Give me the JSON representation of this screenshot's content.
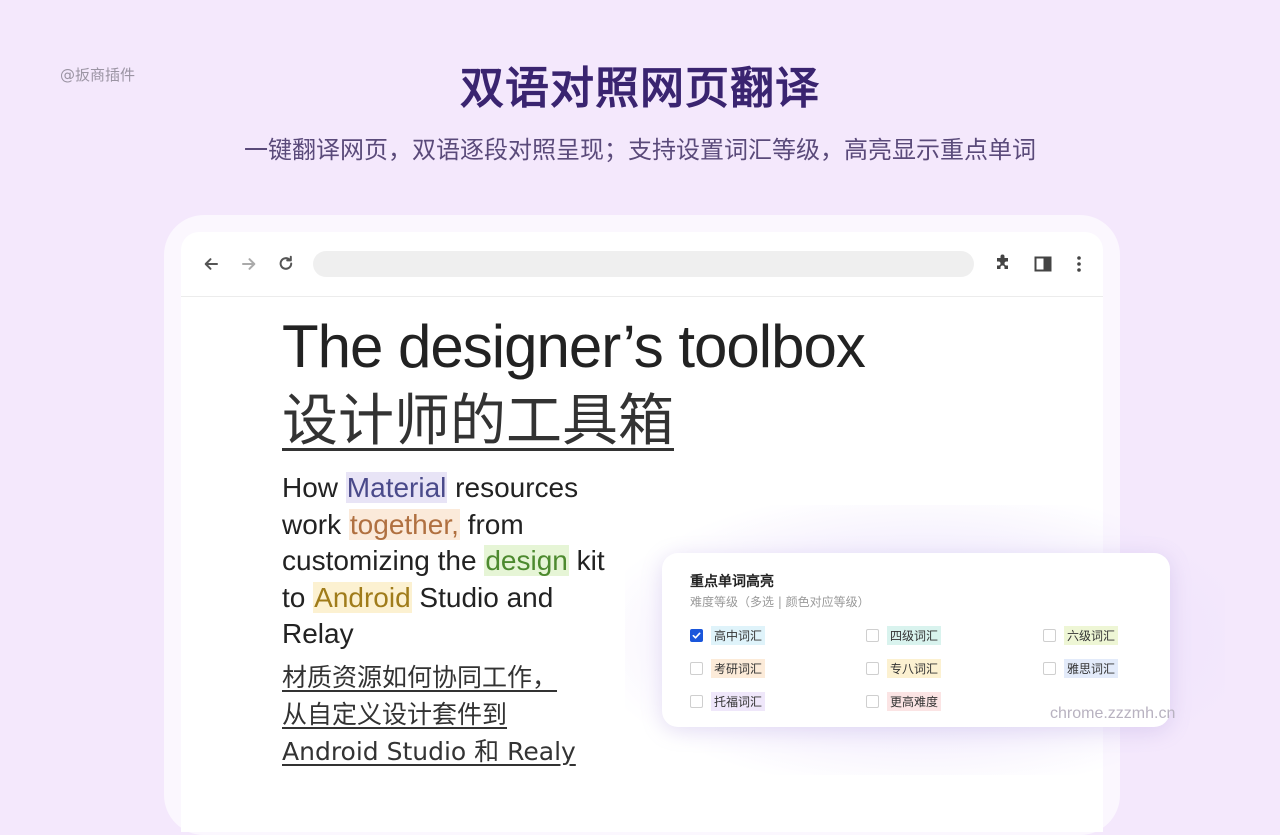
{
  "watermark_top": "@扳商插件",
  "headline": "双语对照网页翻译",
  "subheadline": "一键翻译网页，双语逐段对照呈现；支持设置词汇等级，高亮显示重点单词",
  "browser": {
    "address": "",
    "nav_icons": [
      "back-arrow-icon",
      "forward-arrow-icon",
      "reload-icon"
    ],
    "tool_icons": [
      "puzzle-piece-icon",
      "side-panel-icon",
      "more-vert-icon"
    ]
  },
  "article": {
    "title_en": "The designer’s toolbox",
    "title_zh": "设计师的工具箱",
    "para_en": {
      "part1": "How ",
      "hl1": "Material",
      "part2": " resources work ",
      "hl2": "together,",
      "part3": " from customizing the ",
      "hl3": "design",
      "part4": " kit to ",
      "hl4": "Android",
      "part5": " Studio and Relay"
    },
    "para_zh_lines": [
      "材质资源如何协同工作，",
      "从自定义设计套件到",
      "Android Studio 和 Realy"
    ]
  },
  "panel": {
    "title": "重点单词高亮",
    "subtitle": "难度等级（多选 | 颜色对应等级）",
    "options": [
      {
        "label": "高中词汇",
        "checked": true,
        "color": "#dff3fa"
      },
      {
        "label": "四级词汇",
        "checked": false,
        "color": "#d9f3ee"
      },
      {
        "label": "六级词汇",
        "checked": false,
        "color": "#eef6d5"
      },
      {
        "label": "考研词汇",
        "checked": false,
        "color": "#fcebd9"
      },
      {
        "label": "专八词汇",
        "checked": false,
        "color": "#fcf1d1"
      },
      {
        "label": "雅思词汇",
        "checked": false,
        "color": "#e3ebfa"
      },
      {
        "label": "托福词汇",
        "checked": false,
        "color": "#efe7fa"
      },
      {
        "label": "更高难度",
        "checked": false,
        "color": "#fbe4e4"
      }
    ]
  },
  "watermark_bottom": "chrome.zzzmh.cn",
  "colors": {
    "background": "#f4e8fc",
    "headline": "#3a2470",
    "checkbox_checked": "#1a56db"
  }
}
